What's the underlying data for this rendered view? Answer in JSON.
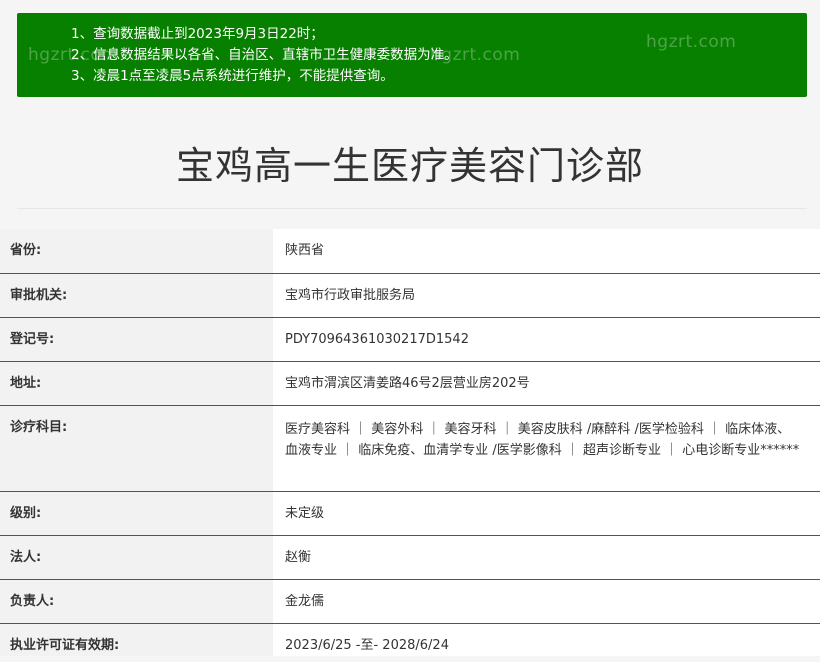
{
  "notice": {
    "lines": [
      "1、查询数据截止到2023年9月3日22时；",
      "2、信息数据结果以各省、自治区、直辖市卫生健康委数据为准。",
      "3、凌晨1点至凌晨5点系统进行维护，不能提供查询。"
    ],
    "watermark": "hgzrt.com",
    "bg_color": "#078000"
  },
  "title": "宝鸡高一生医疗美容门诊部",
  "rows": [
    {
      "label": "省份:",
      "value": "陕西省"
    },
    {
      "label": "审批机关:",
      "value": "宝鸡市行政审批服务局"
    },
    {
      "label": "登记号:",
      "value": "PDY70964361030217D1542"
    },
    {
      "label": "地址:",
      "value": "宝鸡市渭滨区清姜路46号2层营业房202号"
    },
    {
      "label": "诊疗科目:",
      "value": "医疗美容科 ｜ 美容外科 ｜ 美容牙科 ｜ 美容皮肤科 /麻醉科 /医学检验科 ｜ 临床体液、血液专业 ｜ 临床免疫、血清学专业 /医学影像科 ｜ 超声诊断专业 ｜ 心电诊断专业******"
    },
    {
      "label": "级别:",
      "value": "未定级"
    },
    {
      "label": "法人:",
      "value": "赵衡"
    },
    {
      "label": "负责人:",
      "value": "金龙儒"
    },
    {
      "label": "执业许可证有效期:",
      "value": "2023/6/25 -至- 2028/6/24"
    }
  ],
  "colors": {
    "row_border": "#1f7a1f",
    "label_bg": "#f2f2f2",
    "value_bg": "#ffffff"
  }
}
